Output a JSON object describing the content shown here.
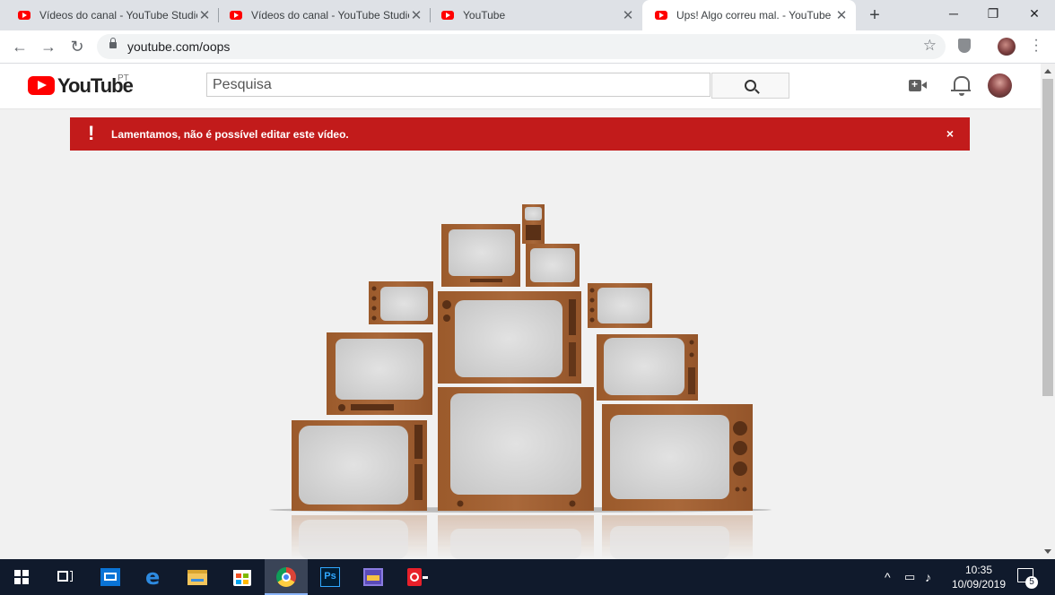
{
  "browser": {
    "tabs": [
      {
        "title": "Vídeos do canal - YouTube Studio",
        "active": false
      },
      {
        "title": "Vídeos do canal - YouTube Studio",
        "active": false
      },
      {
        "title": "YouTube",
        "active": false
      },
      {
        "title": "Ups! Algo correu mal. - YouTube",
        "active": true
      }
    ],
    "new_tab_label": "+",
    "url": "youtube.com/oops"
  },
  "youtube": {
    "logo_text": "YouTube",
    "country_code": "PT",
    "search_placeholder": "Pesquisa"
  },
  "error_banner": {
    "icon": "!",
    "message": "Lamentamos, não é possível editar este vídeo.",
    "close_label": "×",
    "color": "#c21b1b"
  },
  "illustration": {
    "description_icon": "stacked-tvs-illustration",
    "wood_color": "#a2602f",
    "screen_color": "#d9d9d9"
  },
  "taskbar": {
    "time": "10:35",
    "date": "10/09/2019",
    "notification_count": "5",
    "apps": [
      "start-icon",
      "task-view-icon",
      "mail-icon",
      "edge-icon",
      "file-explorer-icon",
      "store-icon",
      "chrome-icon",
      "photoshop-icon",
      "photos-icon",
      "app-icon"
    ]
  }
}
